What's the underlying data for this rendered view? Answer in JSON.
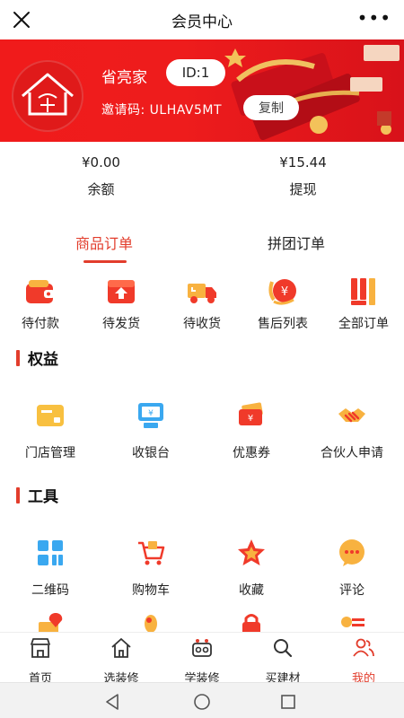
{
  "header": {
    "title": "会员中心",
    "more": "•••"
  },
  "profile": {
    "username": "省亮家",
    "id_label": "ID:1",
    "invite_label": "邀请码:",
    "invite_code": "ULHAV5MT",
    "copy_label": "复制"
  },
  "stats": [
    {
      "value": "¥0.00",
      "label": "余额"
    },
    {
      "value": "¥15.44",
      "label": "提现"
    }
  ],
  "tabs": [
    {
      "label": "商品订单",
      "active": true
    },
    {
      "label": "拼团订单",
      "active": false
    }
  ],
  "orders": [
    {
      "label": "待付款",
      "icon": "wallet-icon"
    },
    {
      "label": "待发货",
      "icon": "box-upload-icon"
    },
    {
      "label": "待收货",
      "icon": "truck-icon"
    },
    {
      "label": "售后列表",
      "icon": "yen-coin-icon"
    },
    {
      "label": "全部订单",
      "icon": "all-orders-icon"
    }
  ],
  "sections": {
    "rights": {
      "title": "权益",
      "items": [
        {
          "label": "门店管理",
          "icon": "card-icon"
        },
        {
          "label": "收银台",
          "icon": "cashier-icon"
        },
        {
          "label": "优惠券",
          "icon": "coupon-icon"
        },
        {
          "label": "合伙人申请",
          "icon": "handshake-icon"
        }
      ]
    },
    "tools": {
      "title": "工具",
      "items": [
        {
          "label": "二维码",
          "icon": "qrcode-icon"
        },
        {
          "label": "购物车",
          "icon": "cart-icon"
        },
        {
          "label": "收藏",
          "icon": "star-icon"
        },
        {
          "label": "评论",
          "icon": "comment-icon"
        }
      ]
    }
  },
  "tabbar": [
    {
      "label": "首页",
      "icon": "store-icon",
      "active": false
    },
    {
      "label": "选装修",
      "icon": "house-icon",
      "active": false
    },
    {
      "label": "学装修",
      "icon": "camera-icon",
      "active": false
    },
    {
      "label": "买建材",
      "icon": "search-icon",
      "active": false
    },
    {
      "label": "我的",
      "icon": "user-icon",
      "active": true
    }
  ],
  "colors": {
    "accent": "#e23d2c",
    "banner": "#ee1c1c"
  }
}
